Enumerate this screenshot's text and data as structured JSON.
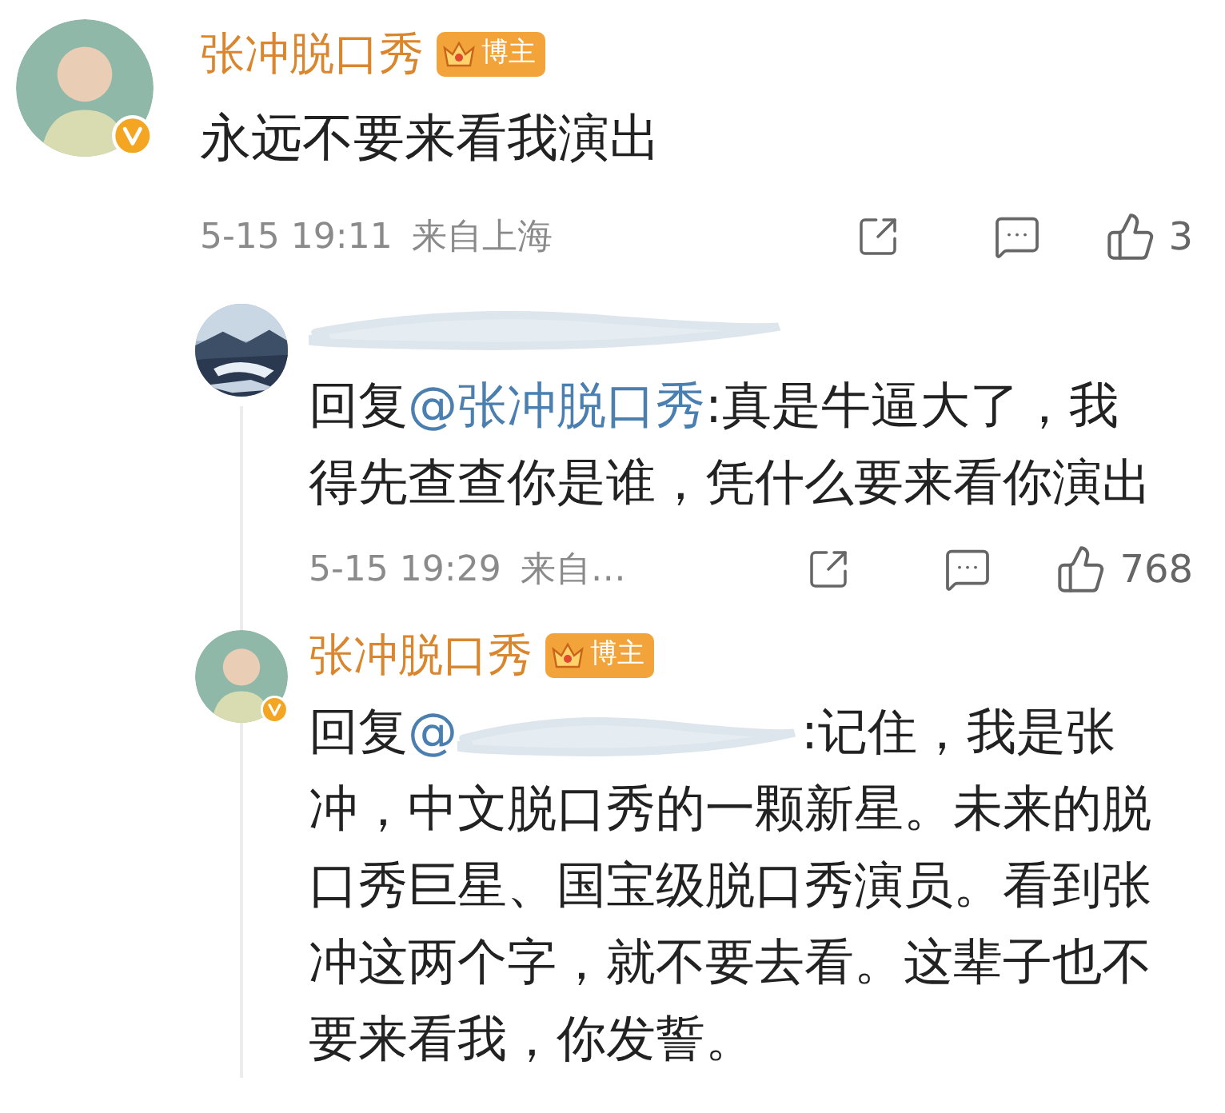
{
  "comment": {
    "avatar": {
      "kind": "person"
    },
    "author": "张冲脱口秀",
    "verified": true,
    "badge": "博主",
    "text": "永远不要来看我演出",
    "time": "5-15 19:11",
    "location": "来自上海",
    "likes": "3",
    "replies": [
      {
        "author_hidden": true,
        "verified": false,
        "reply_prefix": "回复",
        "mention": "@张冲脱口秀",
        "mention_hidden": false,
        "text": ":真是牛逼大了，我得先查查你是谁，凭什么要来看你演出",
        "time": "5-15 19:29",
        "location": "来自…",
        "likes": "768"
      },
      {
        "avatar": {
          "kind": "person"
        },
        "author": "张冲脱口秀",
        "author_hidden": false,
        "verified": true,
        "badge": "博主",
        "reply_prefix": "回复",
        "mention": "@",
        "mention_hidden": true,
        "text": ":记住，我是张冲，中文脱口秀的一颗新星。未来的脱口秀巨星、国宝级脱口秀演员。看到张冲这两个字，就不要去看。这辈子也不要来看我，你发誓。"
      }
    ]
  }
}
